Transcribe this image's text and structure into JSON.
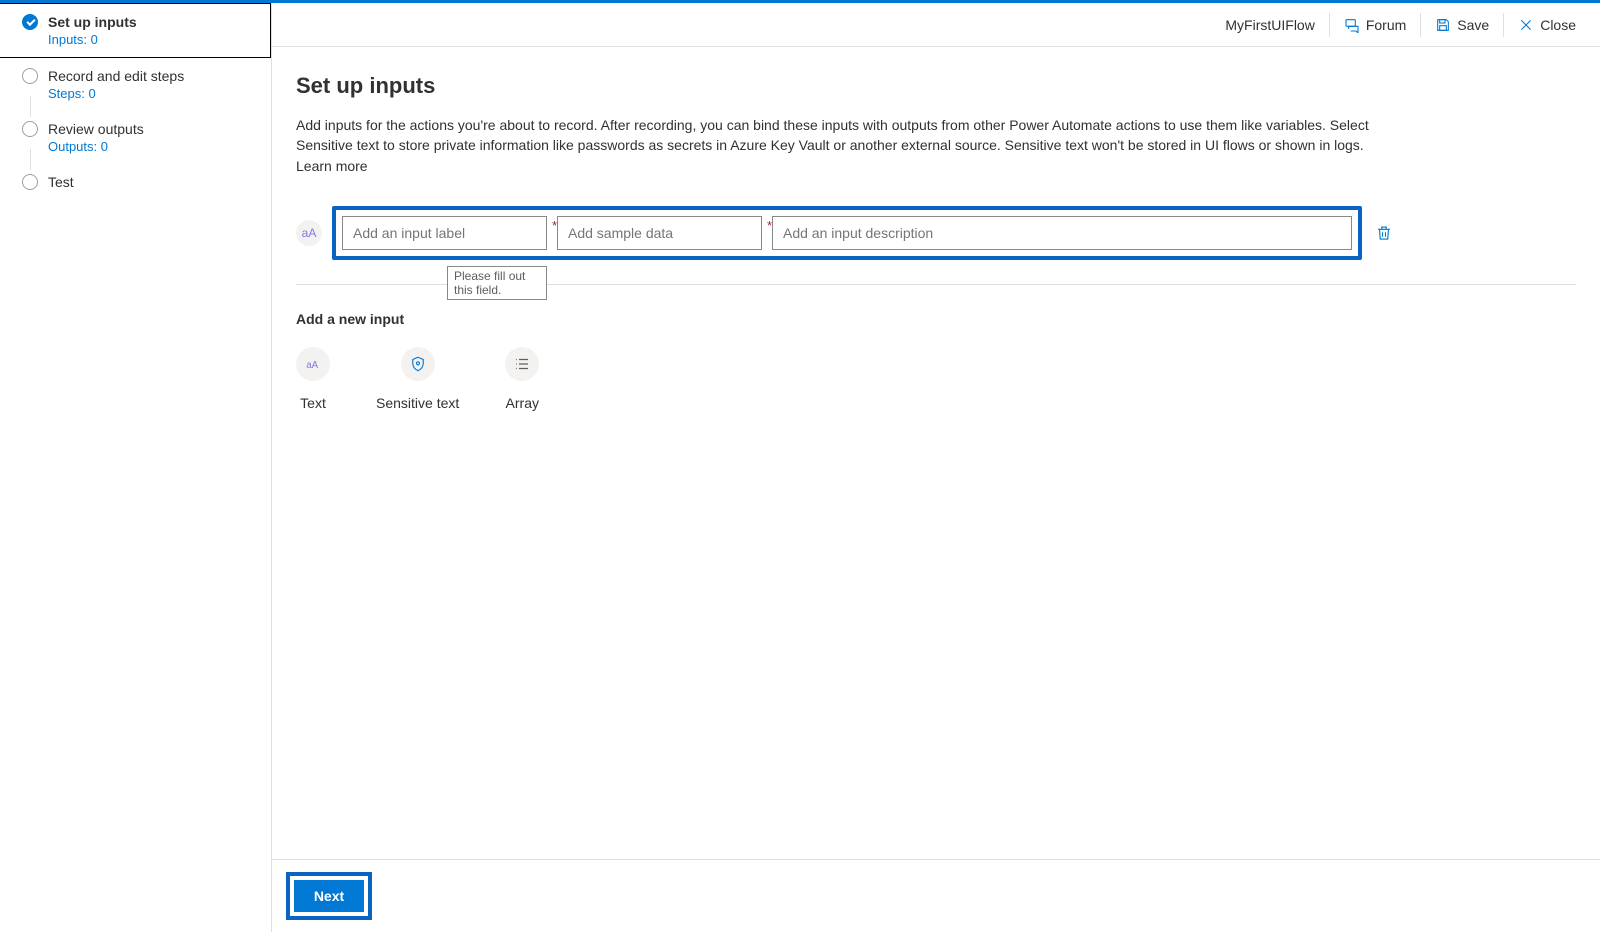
{
  "header": {
    "flow_name": "MyFirstUIFlow",
    "forum": "Forum",
    "save": "Save",
    "close": "Close"
  },
  "sidebar": {
    "steps": [
      {
        "title": "Set up inputs",
        "sub": "Inputs: 0",
        "active": true
      },
      {
        "title": "Record and edit steps",
        "sub": "Steps: 0",
        "active": false
      },
      {
        "title": "Review outputs",
        "sub": "Outputs: 0",
        "active": false
      },
      {
        "title": "Test",
        "sub": "",
        "active": false
      }
    ]
  },
  "page": {
    "title": "Set up inputs",
    "description": "Add inputs for the actions you're about to record. After recording, you can bind these inputs with outputs from other Power Automate actions to use them like variables. Select Sensitive text to store private information like passwords as secrets in Azure Key Vault or another external source. Sensitive text won't be stored in UI flows or shown in logs. Learn more"
  },
  "input_row": {
    "type_glyph": "aA",
    "label_placeholder": "Add an input label",
    "sample_placeholder": "Add sample data",
    "desc_placeholder": "Add an input description",
    "tooltip": "Please fill out this field."
  },
  "add_new": {
    "heading": "Add a new input",
    "options": [
      {
        "key": "text",
        "label": "Text"
      },
      {
        "key": "sensitive",
        "label": "Sensitive text"
      },
      {
        "key": "array",
        "label": "Array"
      }
    ]
  },
  "footer": {
    "next": "Next"
  }
}
